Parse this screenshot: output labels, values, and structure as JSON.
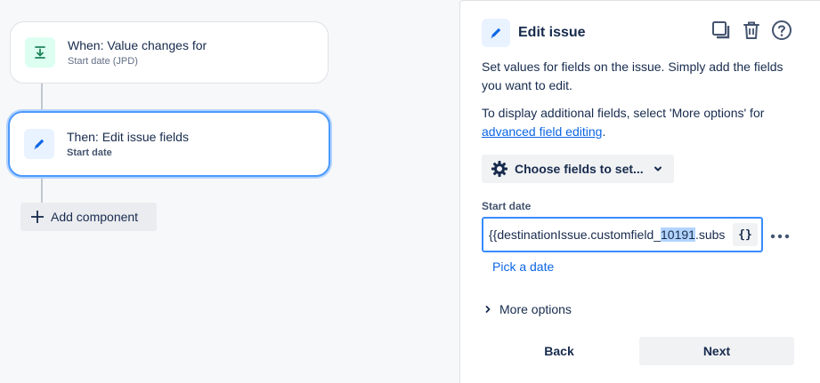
{
  "flow": {
    "trigger": {
      "title": "When: Value changes for",
      "subtitle": "Start date (JPD)",
      "icon": "arrow-down-to-line-icon"
    },
    "action": {
      "title": "Then: Edit issue fields",
      "subtitle": "Start date",
      "icon": "pencil-icon"
    },
    "add_component_label": "Add component"
  },
  "panel": {
    "title": "Edit issue",
    "description_1": "Set values for fields on the issue. Simply add the fields you want to edit.",
    "description_2_prefix": "To display additional fields, select 'More options' for ",
    "description_2_link": "advanced field editing",
    "description_2_suffix": ".",
    "choose_fields_label": "Choose fields to set...",
    "field": {
      "label": "Start date",
      "value_before": "{{destinationIssue.customfield_",
      "value_selected": "10191",
      "value_after": ".subs",
      "smart_value_button": "{}"
    },
    "pick_date_label": "Pick a date",
    "more_options_label": "More options",
    "back_label": "Back",
    "next_label": "Next"
  },
  "colors": {
    "accent": "#0c66e4",
    "focus_border": "#388bff",
    "selection": "#b3d4ff",
    "trigger_icon": "#1f845a",
    "action_icon": "#0c66e4"
  }
}
